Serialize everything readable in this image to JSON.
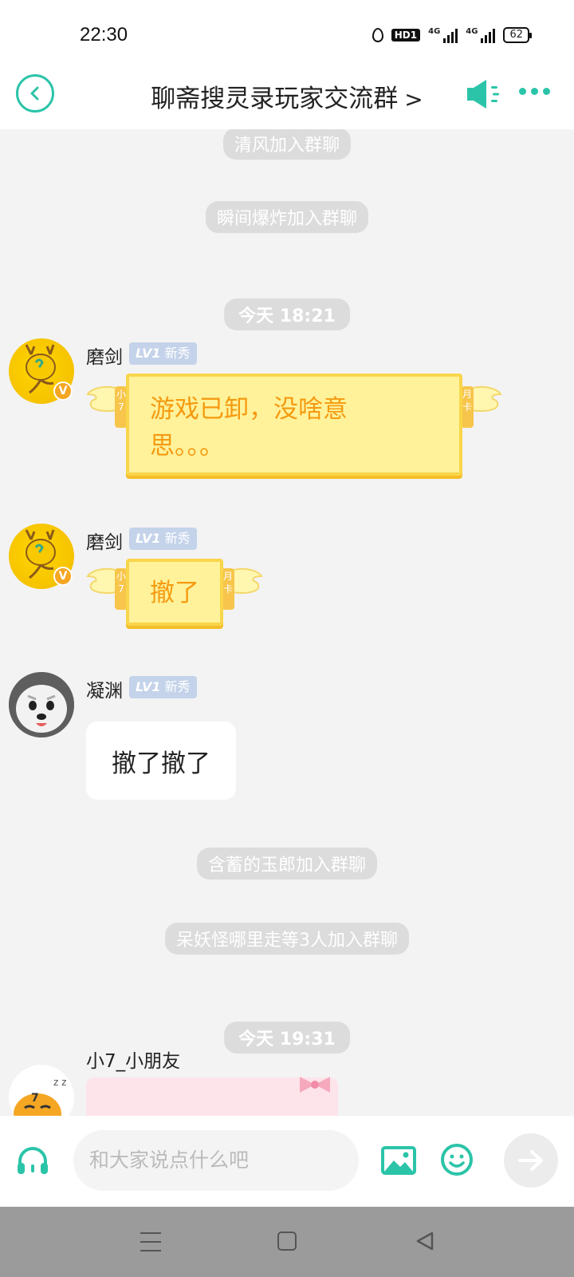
{
  "status_bar": {
    "time": "22:30",
    "hd_label": "HD1",
    "signal1": "4G",
    "signal2": "4G",
    "battery": "62"
  },
  "header": {
    "title": "聊斋搜灵录玩家交流群",
    "chevron": ">",
    "back_icon": "back-circle-icon",
    "speaker_icon": "megaphone-icon",
    "more_icon": "more-dots-icon",
    "accent_color": "#2bc4a9"
  },
  "chat": {
    "system_messages": [
      "清风加入群聊",
      "瞬间爆炸加入群聊",
      "含蓄的玉郎加入群聊",
      "呆妖怪哪里走等3人加入群聊"
    ],
    "time_badges": [
      "今天 18:21",
      "今天 19:31"
    ],
    "messages": [
      {
        "name": "磨剑",
        "level": "LV1",
        "level_title": "新秀",
        "text_line1": "游戏已卸，没啥意",
        "text_line2": "思。。。",
        "vip_left": "小7",
        "vip_right": "月卡",
        "badge": "V"
      },
      {
        "name": "磨剑",
        "level": "LV1",
        "level_title": "新秀",
        "text": "撤了",
        "vip_left": "小7",
        "vip_right": "月卡",
        "badge": "V"
      },
      {
        "name": "凝渊",
        "level": "LV1",
        "level_title": "新秀",
        "text": "撤了撤了"
      },
      {
        "name": "小7_小朋友"
      }
    ]
  },
  "input_bar": {
    "placeholder": "和大家说点什么吧",
    "voice_icon": "headset-icon",
    "image_icon": "image-icon",
    "emoji_icon": "smiley-icon",
    "send_icon": "arrow-right-icon"
  },
  "nav_bar": {
    "menu_icon": "menu-icon",
    "home_icon": "home-square-icon",
    "back_icon": "back-triangle-icon"
  }
}
